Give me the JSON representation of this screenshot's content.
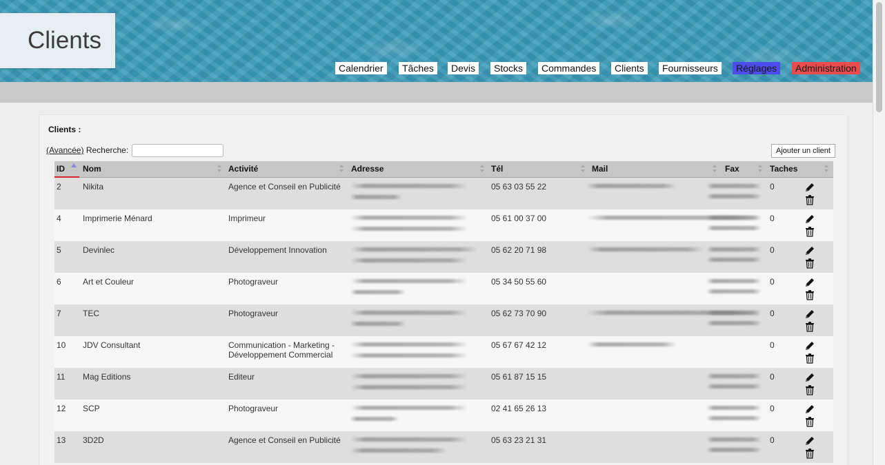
{
  "page": {
    "title": "Clients"
  },
  "nav": {
    "items": [
      {
        "label": "Calendrier"
      },
      {
        "label": "Tâches"
      },
      {
        "label": "Devis"
      },
      {
        "label": "Stocks"
      },
      {
        "label": "Commandes"
      },
      {
        "label": "Clients"
      },
      {
        "label": "Fournisseurs"
      },
      {
        "label": "Réglages"
      },
      {
        "label": "Administration"
      }
    ]
  },
  "panel": {
    "title": "Clients :",
    "advanced_label": "(Avancée)",
    "search_label": "Recherche:",
    "search_value": "",
    "add_button": "Ajouter un client"
  },
  "table": {
    "columns": [
      "ID",
      "Nom",
      "Activité",
      "Adresse",
      "Tél",
      "Mail",
      "Fax",
      "Taches"
    ],
    "sorted_column": "ID",
    "rows": [
      {
        "id": "2",
        "nom": "Nikita",
        "activite": "Agence et Conseil en Publicité",
        "tel": "05 63 03 55 22",
        "taches": "0"
      },
      {
        "id": "4",
        "nom": "Imprimerie Ménard",
        "activite": "Imprimeur",
        "tel": "05 61 00 37 00",
        "taches": "0"
      },
      {
        "id": "5",
        "nom": "Devinlec",
        "activite": "Développement Innovation",
        "tel": "05 62 20 71 98",
        "taches": "0"
      },
      {
        "id": "6",
        "nom": "Art et Couleur",
        "activite": "Photograveur",
        "tel": "05 34 50 55 60",
        "taches": "0"
      },
      {
        "id": "7",
        "nom": "TEC",
        "activite": "Photograveur",
        "tel": "05 62 73 70 90",
        "taches": "0"
      },
      {
        "id": "10",
        "nom": "JDV Consultant",
        "activite": "Communication - Marketing - Développement Commercial",
        "tel": "05 67 67 42 12",
        "taches": "0"
      },
      {
        "id": "11",
        "nom": "Mag Editions",
        "activite": "Editeur",
        "tel": "05 61 87 15 15",
        "taches": "0"
      },
      {
        "id": "12",
        "nom": "SCP",
        "activite": "Photograveur",
        "tel": "02 41 65 26 13",
        "taches": "0"
      },
      {
        "id": "13",
        "nom": "3D2D",
        "activite": "Agence et Conseil en Publicité",
        "tel": "05 63 23 21 31",
        "taches": "0"
      }
    ]
  },
  "colors": {
    "reglages": "#4d4ded",
    "administration": "#e84c4c",
    "sort_active": "#d9242a"
  },
  "icons": {
    "edit": "pencil-icon",
    "delete": "trash-icon"
  }
}
